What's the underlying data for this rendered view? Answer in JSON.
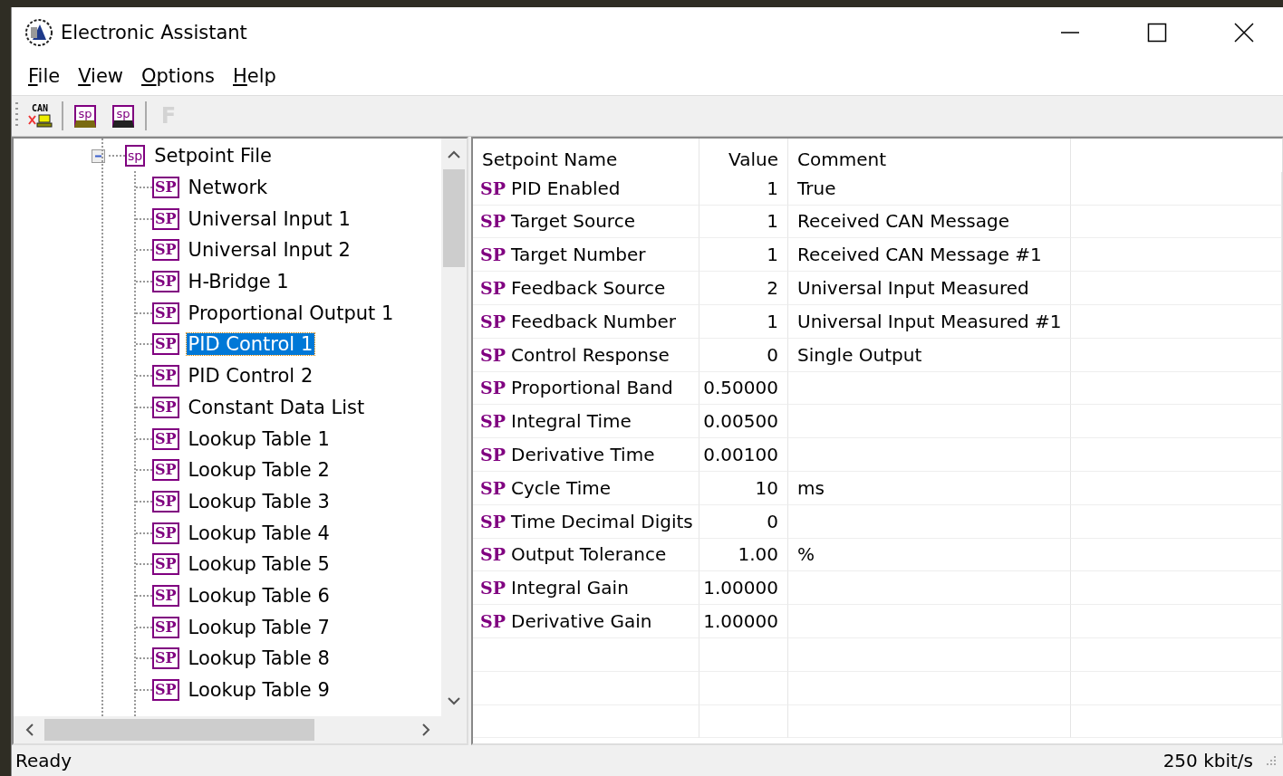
{
  "window": {
    "title": "Electronic Assistant"
  },
  "menu": [
    {
      "label": "File"
    },
    {
      "label": "View"
    },
    {
      "label": "Options"
    },
    {
      "label": "Help"
    }
  ],
  "toolbar": [
    {
      "kind": "can",
      "label": "CAN",
      "disabled": false
    },
    {
      "kind": "sep"
    },
    {
      "kind": "open",
      "label": "sp",
      "disabled": false
    },
    {
      "kind": "save",
      "label": "sp",
      "disabled": false
    },
    {
      "kind": "sep"
    },
    {
      "kind": "letter",
      "label": "F",
      "disabled": true
    }
  ],
  "tree": {
    "items": [
      {
        "label": "Setpoint File",
        "icon_text": "sp",
        "expanded": true,
        "selected": false,
        "children": [
          {
            "label": "Network",
            "icon_text": "SP",
            "selected": false
          },
          {
            "label": "Universal Input 1",
            "icon_text": "SP",
            "selected": false
          },
          {
            "label": "Universal Input 2",
            "icon_text": "SP",
            "selected": false
          },
          {
            "label": "H-Bridge 1",
            "icon_text": "SP",
            "selected": false
          },
          {
            "label": "Proportional Output 1",
            "icon_text": "SP",
            "selected": false
          },
          {
            "label": "PID Control 1",
            "icon_text": "SP",
            "selected": true
          },
          {
            "label": "PID Control 2",
            "icon_text": "SP",
            "selected": false
          },
          {
            "label": "Constant Data List",
            "icon_text": "SP",
            "selected": false
          },
          {
            "label": "Lookup Table 1",
            "icon_text": "SP",
            "selected": false
          },
          {
            "label": "Lookup Table 2",
            "icon_text": "SP",
            "selected": false
          },
          {
            "label": "Lookup Table 3",
            "icon_text": "SP",
            "selected": false
          },
          {
            "label": "Lookup Table 4",
            "icon_text": "SP",
            "selected": false
          },
          {
            "label": "Lookup Table 5",
            "icon_text": "SP",
            "selected": false
          },
          {
            "label": "Lookup Table 6",
            "icon_text": "SP",
            "selected": false
          },
          {
            "label": "Lookup Table 7",
            "icon_text": "SP",
            "selected": false
          },
          {
            "label": "Lookup Table 8",
            "icon_text": "SP",
            "selected": false
          },
          {
            "label": "Lookup Table 9",
            "icon_text": "SP",
            "selected": false
          }
        ]
      }
    ]
  },
  "table": {
    "columns": [
      "Setpoint Name",
      "Value",
      "Comment"
    ],
    "rows": [
      {
        "badge": "SP",
        "name": "PID Enabled",
        "value": "1",
        "comment": "True"
      },
      {
        "badge": "SP",
        "name": "Target Source",
        "value": "1",
        "comment": "Received CAN Message"
      },
      {
        "badge": "SP",
        "name": "Target Number",
        "value": "1",
        "comment": "Received CAN Message #1"
      },
      {
        "badge": "SP",
        "name": "Feedback Source",
        "value": "2",
        "comment": "Universal Input Measured"
      },
      {
        "badge": "SP",
        "name": "Feedback Number",
        "value": "1",
        "comment": "Universal Input Measured #1"
      },
      {
        "badge": "SP",
        "name": "Control Response",
        "value": "0",
        "comment": "Single Output"
      },
      {
        "badge": "SP",
        "name": "Proportional Band",
        "value": "0.50000"
      },
      {
        "badge": "SP",
        "name": "Integral Time",
        "value": "0.00500"
      },
      {
        "badge": "SP",
        "name": "Derivative Time",
        "value": "0.00100"
      },
      {
        "badge": "SP",
        "name": "Cycle Time",
        "value": "10",
        "comment": "ms"
      },
      {
        "badge": "SP",
        "name": "Time Decimal Digits",
        "value": "0"
      },
      {
        "badge": "SP",
        "name": "Output Tolerance",
        "value": "1.00",
        "comment": "%"
      },
      {
        "badge": "SP",
        "name": "Integral Gain",
        "value": "1.00000"
      },
      {
        "badge": "SP",
        "name": "Derivative Gain",
        "value": "1.00000"
      }
    ]
  },
  "status_bar": {
    "message": "Ready",
    "bitrate": "250 kbit/s"
  }
}
